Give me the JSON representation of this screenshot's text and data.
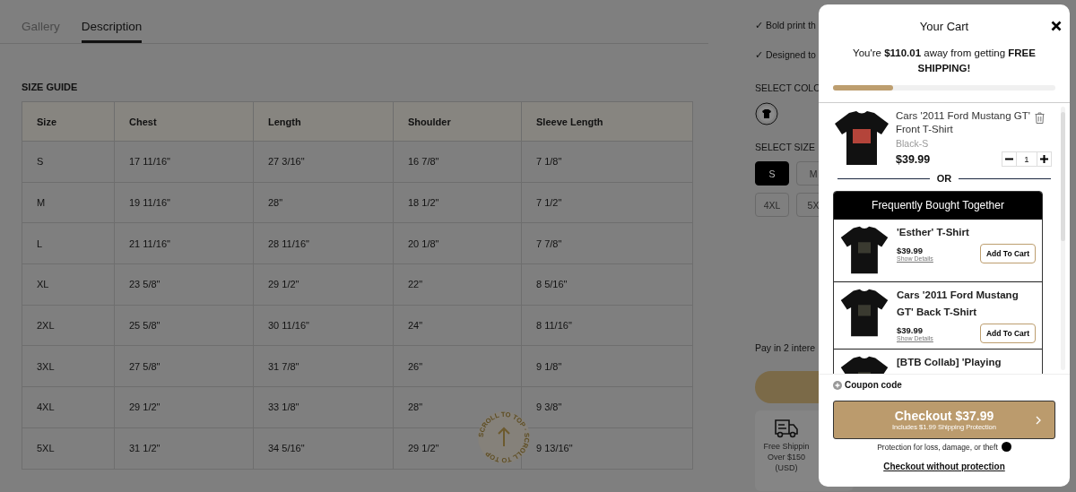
{
  "tabs": [
    {
      "label": "Gallery",
      "selected": false
    },
    {
      "label": "Description",
      "selected": true
    }
  ],
  "size_guide": {
    "title": "SIZE GUIDE",
    "columns": [
      "Size",
      "Chest",
      "Length",
      "Shoulder",
      "Sleeve Length"
    ],
    "rows": [
      [
        "S",
        "17 11/16\"",
        "27 3/16\"",
        "16 7/8\"",
        "7 1/8\""
      ],
      [
        "M",
        "19 11/16\"",
        "28\"",
        "18 1/2\"",
        "7 1/2\""
      ],
      [
        "L",
        "21 11/16\"",
        "28 11/16\"",
        "20 1/8\"",
        "7 7/8\""
      ],
      [
        "XL",
        "23 5/8\"",
        "29 1/2\"",
        "22\"",
        "8 5/16\""
      ],
      [
        "2XL",
        "25 5/8\"",
        "30 11/16\"",
        "24\"",
        "8 11/16\""
      ],
      [
        "3XL",
        "27 5/8\"",
        "31 7/8\"",
        "26\"",
        "9 1/8\""
      ],
      [
        "4XL",
        "29 1/2\"",
        "33 1/8\"",
        "28\"",
        "9 3/8\""
      ],
      [
        "5XL",
        "31 1/2\"",
        "34 5/16\"",
        "29 1/2\"",
        "9 13/16\""
      ]
    ]
  },
  "scroll_to_top": {
    "label": "SCROLL TO TOP · SCROLL TO TOP"
  },
  "product_panel": {
    "features": [
      "✓ Bold print th",
      "✓ Designed to"
    ],
    "color_label": "SELECT COLO",
    "size_label": "SELECT SIZE",
    "sizes": [
      {
        "label": "S",
        "selected": true
      },
      {
        "label": "M",
        "selected": false
      },
      {
        "label": "4XL",
        "selected": false
      },
      {
        "label": "5X",
        "selected": false
      }
    ],
    "pay_note": "Pay in 2 intere",
    "shipping_card": [
      "Free Shippin",
      "Over $150",
      "(USD)"
    ]
  },
  "cart": {
    "title": "Your Cart",
    "free_shipping_message": "You're **$110.01** away from getting **FREE SHIPPING!**",
    "progress": {
      "level": 0.27
    },
    "item": {
      "title": "Cars '2011 Ford Mustang GT' Front T-Shirt",
      "variant": "Black-S",
      "price": "$39.99",
      "quantity": "1"
    },
    "separator": "OR",
    "bundle": {
      "title": "Frequently Bought Together",
      "items": [
        {
          "title": "'Esther' T-Shirt",
          "price": "$39.99",
          "details_link": "Show Details",
          "button": "Add To Cart"
        },
        {
          "title": "Cars '2011 Ford Mustang GT' Back T-Shirt",
          "price": "$39.99",
          "details_link": "Show Details",
          "button": "Add To Cart"
        },
        {
          "title": "[BTB Collab] 'Playing"
        }
      ]
    },
    "coupon": "Coupon code",
    "checkout": {
      "label": "Checkout $37.99",
      "sublabel": "Includes $1.99 Shipping Protection"
    },
    "protection_note": "Protection for loss, damage, or theft",
    "checkout_without": "Checkout without protection"
  }
}
